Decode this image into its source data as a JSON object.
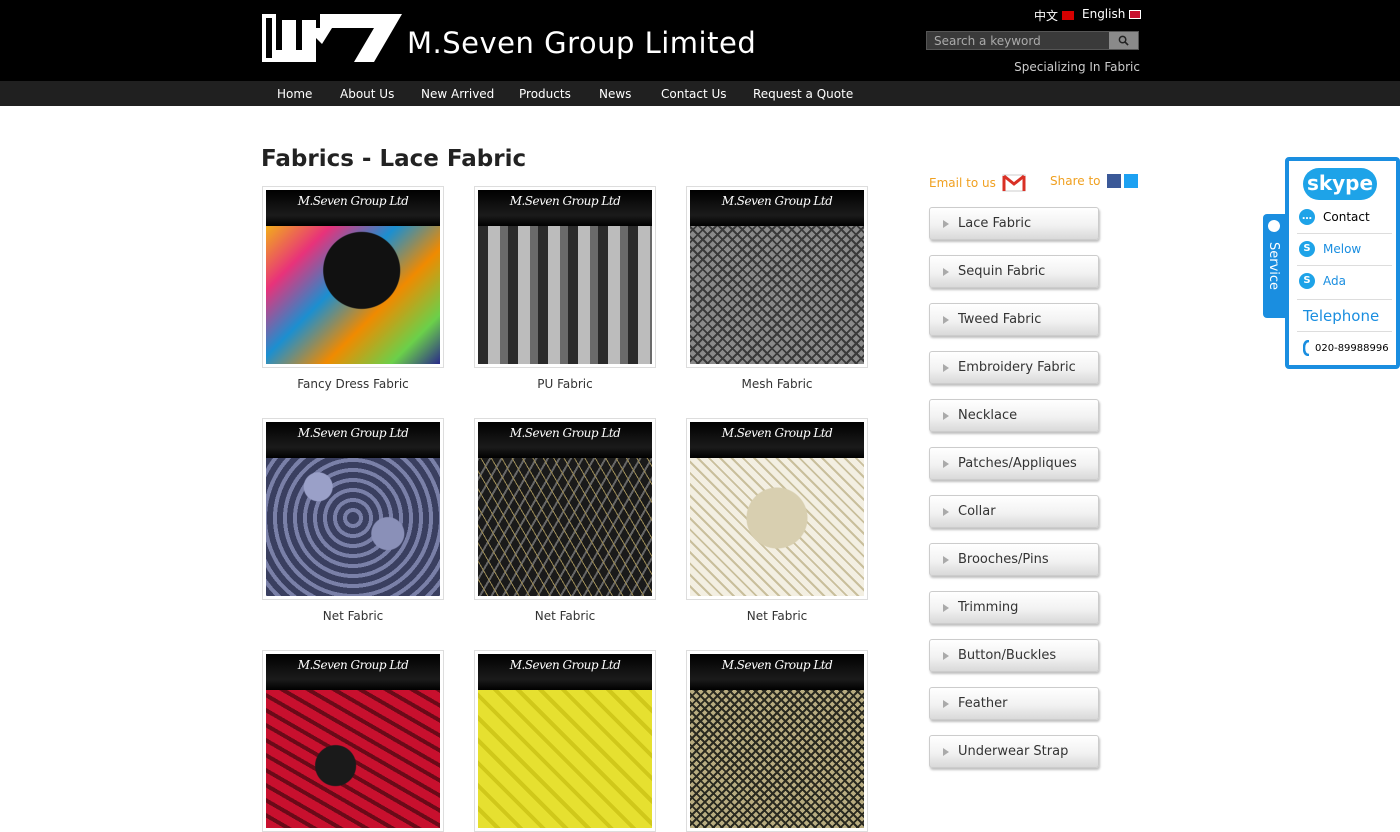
{
  "header": {
    "logo_text": "M.Seven Group Limited",
    "lang_cn": "中文",
    "lang_en": "English",
    "search_placeholder": "Search a keyword",
    "tagline": "Specializing In Fabric"
  },
  "nav": [
    "Home",
    "About Us",
    "New Arrived",
    "Products",
    "News",
    "Contact Us",
    "Request a Quote"
  ],
  "page_title": "Fabrics - Lace Fabric",
  "thumb_watermark": "M.Seven Group Ltd",
  "products": [
    {
      "caption": "Fancy Dress Fabric",
      "swatch": "multicolor-print"
    },
    {
      "caption": "PU Fabric",
      "swatch": "silver-stripe"
    },
    {
      "caption": "Mesh Fabric",
      "swatch": "grey-mesh"
    },
    {
      "caption": "Net Fabric",
      "swatch": "blue-lace"
    },
    {
      "caption": "Net Fabric",
      "swatch": "black-gold-net"
    },
    {
      "caption": "Net Fabric",
      "swatch": "cream-net"
    },
    {
      "caption": "",
      "swatch": "red-lace"
    },
    {
      "caption": "",
      "swatch": "yellow-jacquard"
    },
    {
      "caption": "",
      "swatch": "gold-chain-mesh"
    }
  ],
  "sidebar": {
    "email_label": "Email to us",
    "share_label": "Share to",
    "categories": [
      "Lace Fabric",
      "Sequin Fabric",
      "Tweed Fabric",
      "Embroidery Fabric",
      "Necklace",
      "Patches/Appliques",
      "Collar",
      "Brooches/Pins",
      "Trimming",
      "Button/Buckles",
      "Feather",
      "Underwear Strap"
    ]
  },
  "service": {
    "tab_label": "Service",
    "skype": "skype",
    "contact": "Contact",
    "agents": [
      "Melow",
      "Ada"
    ],
    "telephone_label": "Telephone",
    "telephone": "020-89988996"
  },
  "colors": {
    "accent": "#1a8ee0",
    "orange": "#f0a020",
    "header_bg": "#000000",
    "nav_bg": "#202020"
  }
}
